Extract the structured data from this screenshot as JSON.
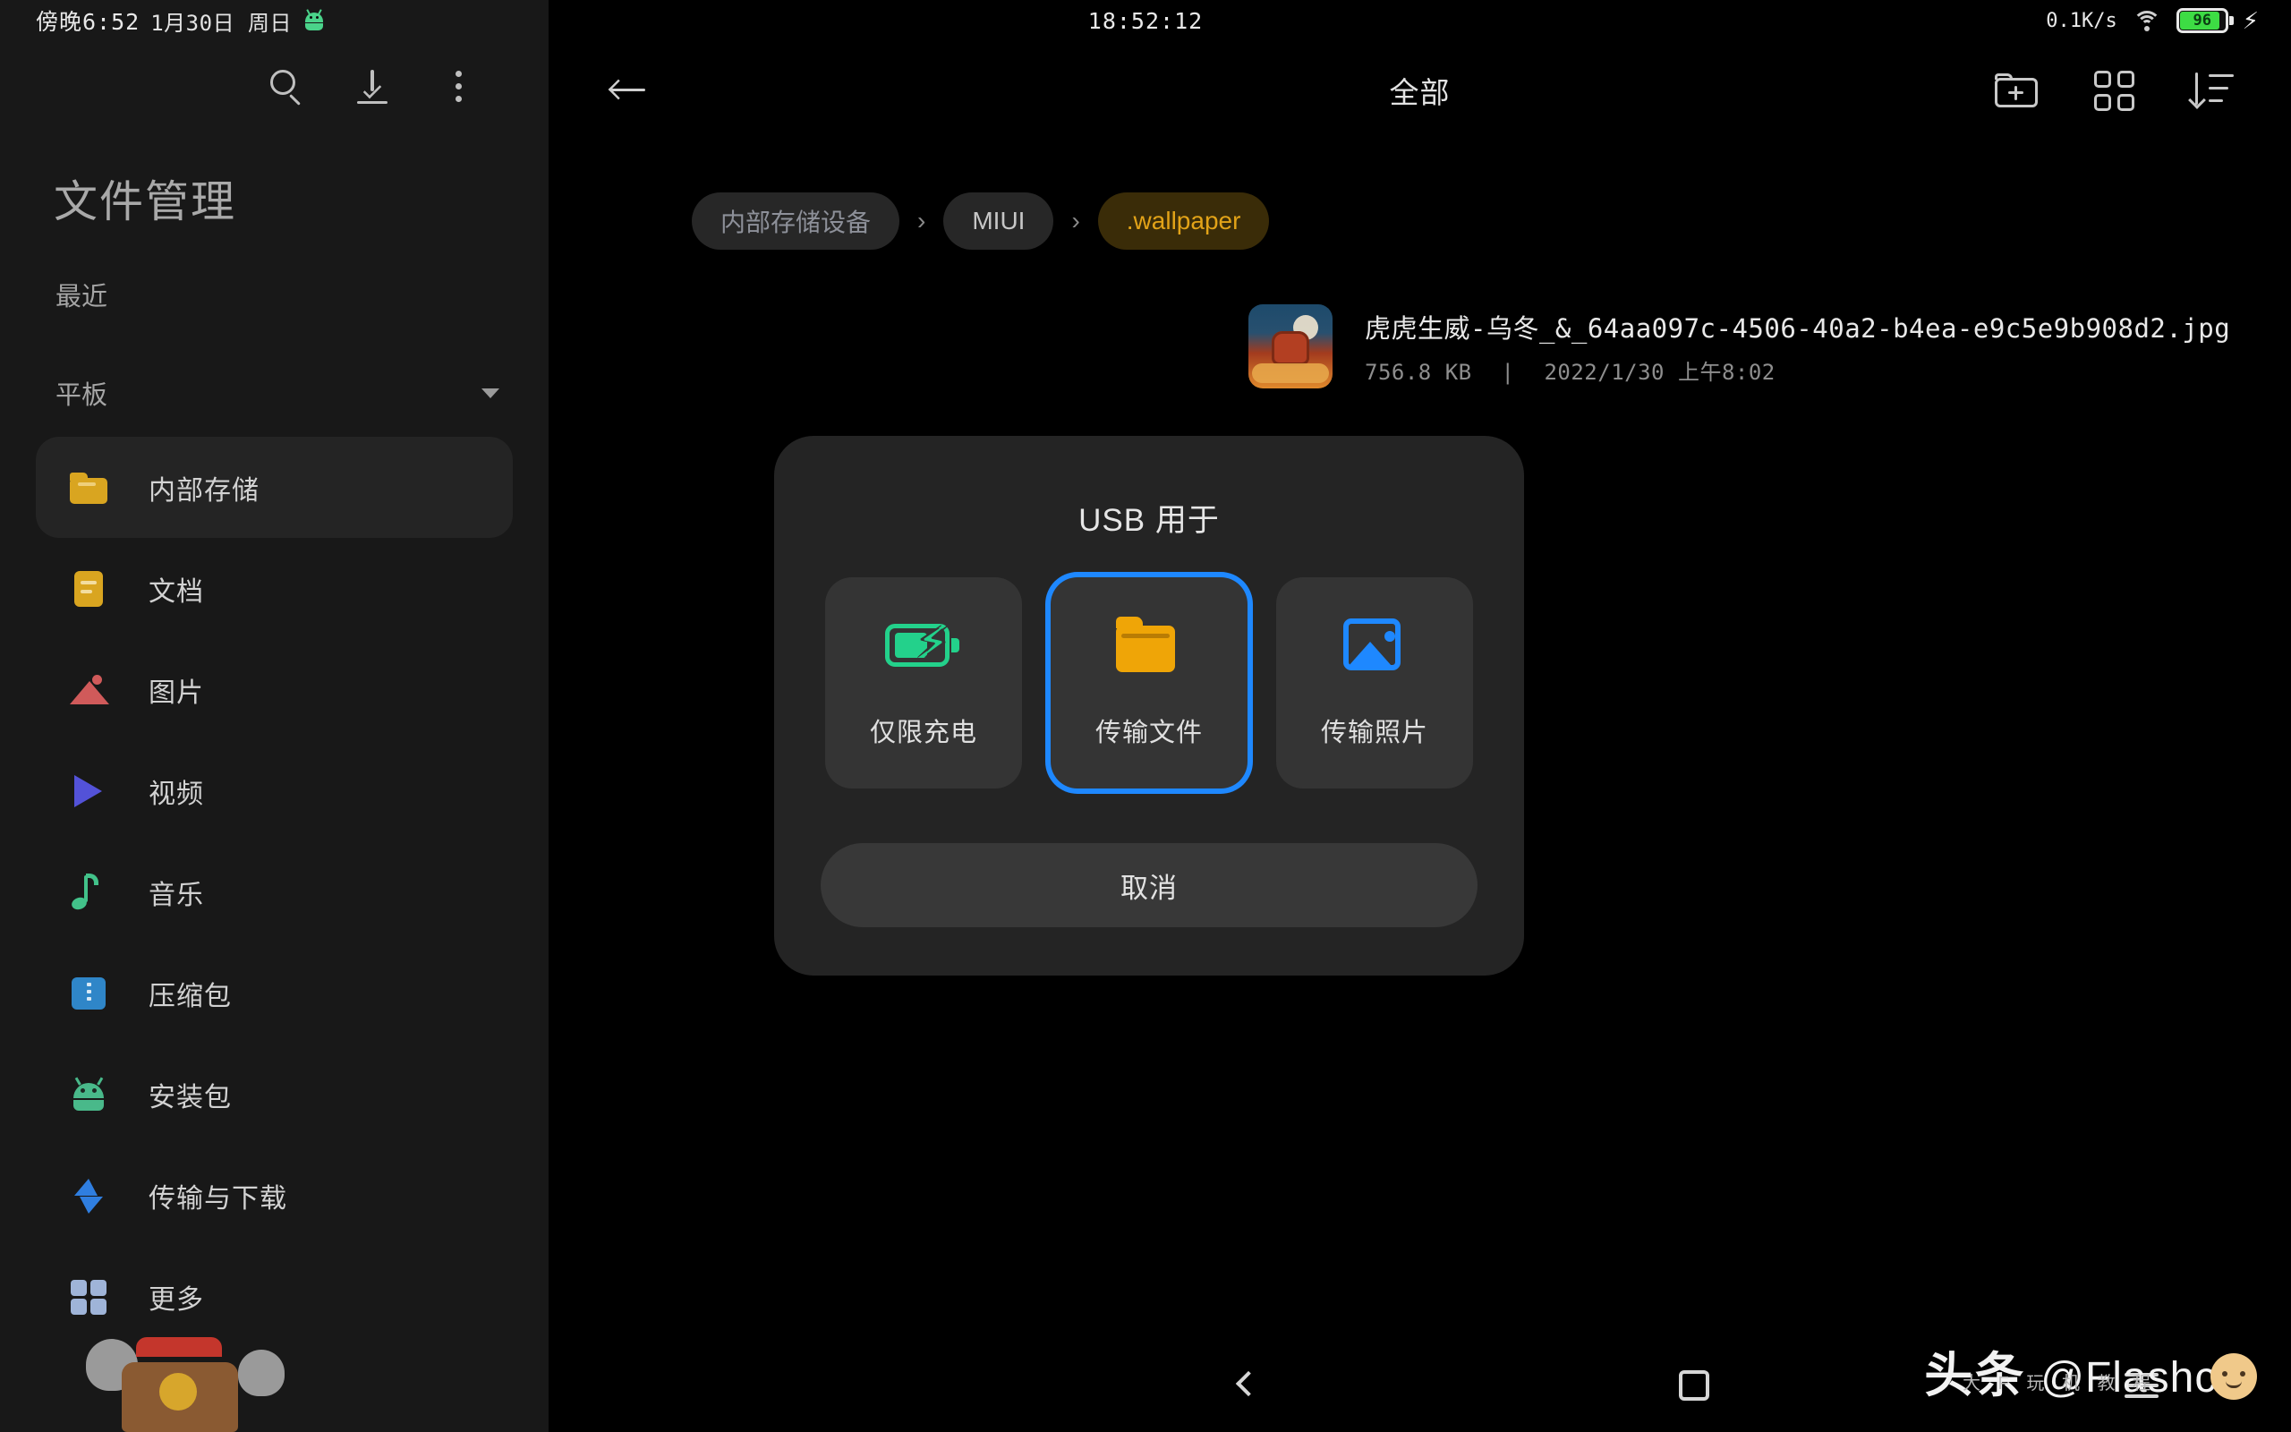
{
  "status_bar": {
    "left_time": "傍晚6:52",
    "left_date": "1月30日 周日",
    "android_icon": "android-robot-icon",
    "center_clock": "18:52:12",
    "network_speed": "0.1K/s",
    "wifi_icon": "wifi-icon",
    "battery_percent": "96",
    "charging_icon": "lightning-bolt-icon"
  },
  "sidebar": {
    "app_title": "文件管理",
    "toolbar": {
      "search_icon": "search-icon",
      "download_icon": "download-icon",
      "overflow_icon": "more-vertical-icon"
    },
    "recent_label": "最近",
    "group_label": "平板",
    "group_caret_icon": "chevron-down-icon",
    "items": [
      {
        "label": "内部存储",
        "icon": "folder-icon",
        "active": true
      },
      {
        "label": "文档",
        "icon": "document-icon",
        "active": false
      },
      {
        "label": "图片",
        "icon": "image-icon",
        "active": false
      },
      {
        "label": "视频",
        "icon": "video-play-icon",
        "active": false
      },
      {
        "label": "音乐",
        "icon": "music-note-icon",
        "active": false
      },
      {
        "label": "压缩包",
        "icon": "zip-archive-icon",
        "active": false
      },
      {
        "label": "安装包",
        "icon": "android-apk-icon",
        "active": false
      },
      {
        "label": "传输与下载",
        "icon": "transfer-bolt-icon",
        "active": false
      },
      {
        "label": "更多",
        "icon": "grid-more-icon",
        "active": false
      }
    ]
  },
  "appbar": {
    "back_icon": "arrow-left-icon",
    "title": "全部",
    "new_folder_icon": "new-folder-icon",
    "grid_view_icon": "grid-view-icon",
    "sort_icon": "sort-descending-icon"
  },
  "breadcrumb": {
    "separator": "›",
    "items": [
      {
        "label": "内部存储设备",
        "current": false
      },
      {
        "label": "MIUI",
        "current": false
      },
      {
        "label": ".wallpaper",
        "current": true
      }
    ]
  },
  "file_list": [
    {
      "name": "虎虎生威-乌冬_&_64aa097c-4506-40a2-b4ea-e9c5e9b908d2.jpg",
      "size": "756.8 KB",
      "separator": "|",
      "date": "2022/1/30 上午8:02",
      "thumb": "image-thumbnail"
    }
  ],
  "usb_dialog": {
    "title": "USB 用于",
    "options": [
      {
        "label": "仅限充电",
        "icon": "battery-charging-icon",
        "selected": false
      },
      {
        "label": "传输文件",
        "icon": "folder-icon",
        "selected": true
      },
      {
        "label": "传输照片",
        "icon": "photo-icon",
        "selected": false
      }
    ],
    "cancel_label": "取消",
    "selection_color": "#1e88ff"
  },
  "navbar": {
    "back_icon": "nav-back-icon",
    "home_icon": "nav-home-icon",
    "recents_icon": "nav-menu-icon"
  },
  "watermark": {
    "logo": "头条",
    "handle": "@Flashcer",
    "sub": "大 F 玩 机 教 程",
    "face_icon": "smiley-face-icon"
  },
  "mascot": {
    "icon": "mi-bunny-mascot"
  },
  "colors": {
    "accent_blue": "#1e88ff",
    "folder_amber": "#efa507",
    "crumb_amber": "#e2a318",
    "battery_green": "#3ddc44",
    "sidebar_bg": "#181818",
    "dialog_bg": "#242424"
  }
}
